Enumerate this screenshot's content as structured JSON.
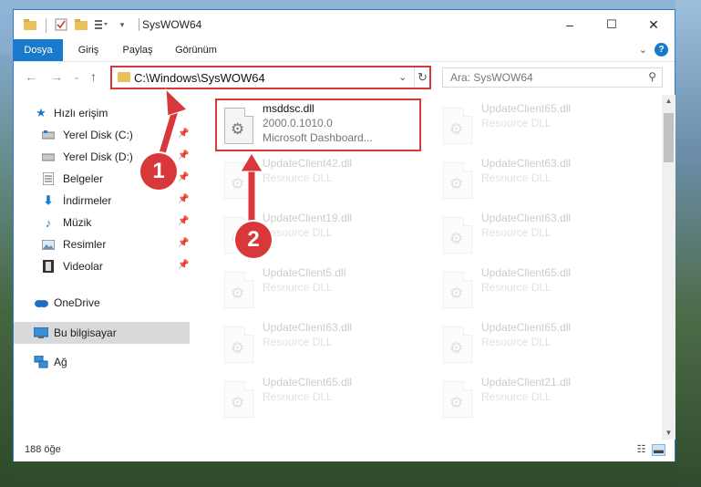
{
  "window": {
    "title": "SysWOW64"
  },
  "quick_access": {
    "icons": [
      "folder-icon",
      "properties-icon",
      "new-folder-icon",
      "customize-icon"
    ]
  },
  "window_controls": {
    "minimize": "–",
    "maximize": "☐",
    "close": "✕"
  },
  "ribbon": {
    "tabs": [
      {
        "label": "Dosya",
        "active": true
      },
      {
        "label": "Giriş"
      },
      {
        "label": "Paylaş"
      },
      {
        "label": "Görünüm"
      }
    ],
    "help_label": "?"
  },
  "navigation": {
    "address": "C:\\Windows\\SysWOW64",
    "search_placeholder": "Ara: SysWOW64"
  },
  "sidebar": {
    "items": [
      {
        "label": "Hızlı erişim",
        "icon": "star-icon",
        "pinned": false
      },
      {
        "label": "Yerel Disk (C:)",
        "icon": "drive-icon",
        "pinned": true
      },
      {
        "label": "Yerel Disk (D:)",
        "icon": "drive-icon",
        "pinned": true
      },
      {
        "label": "Belgeler",
        "icon": "documents-icon",
        "pinned": true
      },
      {
        "label": "İndirmeler",
        "icon": "downloads-icon",
        "pinned": true
      },
      {
        "label": "Müzik",
        "icon": "music-icon",
        "pinned": true
      },
      {
        "label": "Resimler",
        "icon": "pictures-icon",
        "pinned": true
      },
      {
        "label": "Videolar",
        "icon": "videos-icon",
        "pinned": true
      },
      {
        "label": "OneDrive",
        "icon": "cloud-icon",
        "pinned": false
      },
      {
        "label": "Bu bilgisayar",
        "icon": "computer-icon",
        "pinned": false,
        "selected": true
      },
      {
        "label": "Ağ",
        "icon": "network-icon",
        "pinned": false
      }
    ]
  },
  "files": {
    "highlighted": {
      "name": "msddsc.dll",
      "version": "2000.0.1010.0",
      "description": "Microsoft Dashboard..."
    },
    "faded": [
      {
        "name": "UpdateClient65.dll",
        "type": "Resource DLL"
      },
      {
        "name": "UpdateClient42.dll",
        "type": "Resource DLL"
      },
      {
        "name": "UpdateClient63.dll",
        "type": "Resource DLL"
      },
      {
        "name": "UpdateClient19.dll",
        "type": "Resource DLL"
      },
      {
        "name": "UpdateClient63.dll",
        "type": "Resource DLL"
      },
      {
        "name": "UpdateClient5.dll",
        "type": "Resource DLL"
      },
      {
        "name": "UpdateClient65.dll",
        "type": "Resource DLL"
      },
      {
        "name": "UpdateClient63.dll",
        "type": "Resource DLL"
      },
      {
        "name": "UpdateClient65.dll",
        "type": "Resource DLL"
      },
      {
        "name": "UpdateClient65.dll",
        "type": "Resource DLL"
      },
      {
        "name": "UpdateClient21.dll",
        "type": "Resource DLL"
      }
    ]
  },
  "status": {
    "item_count": "188 öğe"
  },
  "annotations": {
    "callout_1": "1",
    "callout_2": "2",
    "color": "#d9383a"
  },
  "colors": {
    "accent": "#1979ca",
    "highlight_border": "#d9383a"
  }
}
